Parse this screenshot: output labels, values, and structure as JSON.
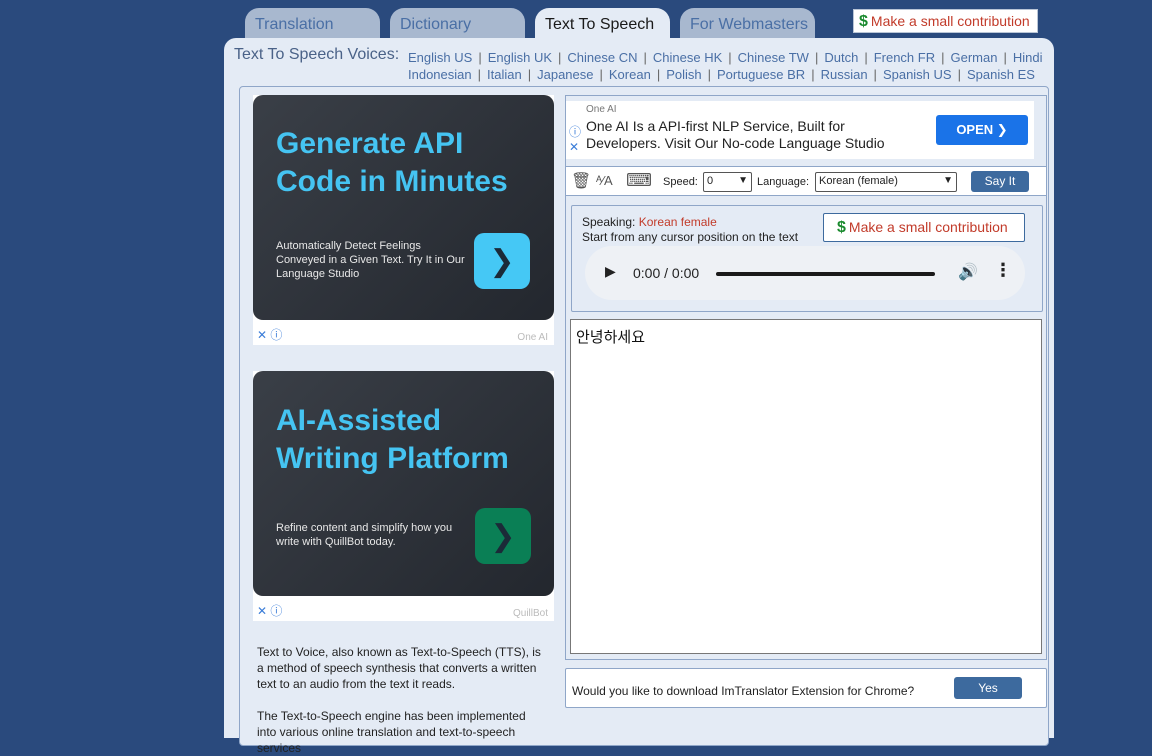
{
  "tabs": [
    {
      "label": "Translation",
      "active": false
    },
    {
      "label": "Dictionary",
      "active": false
    },
    {
      "label": "Text To Speech",
      "active": true
    },
    {
      "label": "For Webmasters",
      "active": false
    }
  ],
  "contribution": {
    "symbol": "$",
    "label": "Make a small contribution"
  },
  "voices": {
    "label": "Text To Speech Voices:",
    "row1": [
      "English US",
      "English UK",
      "Chinese CN",
      "Chinese HK",
      "Chinese TW",
      "Dutch",
      "French FR",
      "German",
      "Hindi"
    ],
    "row2": [
      "Indonesian",
      "Italian",
      "Japanese",
      "Korean",
      "Polish",
      "Portuguese BR",
      "Russian",
      "Spanish US",
      "Spanish ES"
    ]
  },
  "ads": [
    {
      "title": "Generate API Code in Minutes",
      "description": "Automatically Detect Feelings Conveyed in a Given Text. Try It in Our Language Studio",
      "brand": "One AI",
      "button_color": "#45c8f5"
    },
    {
      "title": "AI-Assisted Writing Platform",
      "description": "Refine content and simplify how you write with QuillBot today.",
      "brand": "QuillBot",
      "button_color": "#0a7f55"
    }
  ],
  "ad_controls": {
    "close": "✕",
    "info": "ⓘ"
  },
  "banner_ad": {
    "source": "One AI",
    "text": "One AI Is a API-first NLP Service, Built for Developers. Visit Our No-code Language Studio",
    "button": "OPEN",
    "button_arrow": "❯"
  },
  "description": {
    "p1": "Text to Voice, also known as Text-to-Speech (TTS), is a method of speech synthesis that converts a written text to an audio from the text it reads.",
    "p2": "The Text-to-Speech engine has been implemented into various online translation and text-to-speech services"
  },
  "toolbar": {
    "speed_label": "Speed:",
    "speed_value": "0",
    "language_label": "Language:",
    "language_value": "Korean (female)",
    "say_it": "Say It"
  },
  "speaking": {
    "label": "Speaking:",
    "voice": "Korean female",
    "hint": "Start from any cursor position on the text"
  },
  "audio": {
    "time": "0:00 / 0:00"
  },
  "text_input": "안녕하세요",
  "chrome_prompt": {
    "question": "Would you like to download ImTranslator Extension for Chrome?",
    "yes": "Yes"
  }
}
